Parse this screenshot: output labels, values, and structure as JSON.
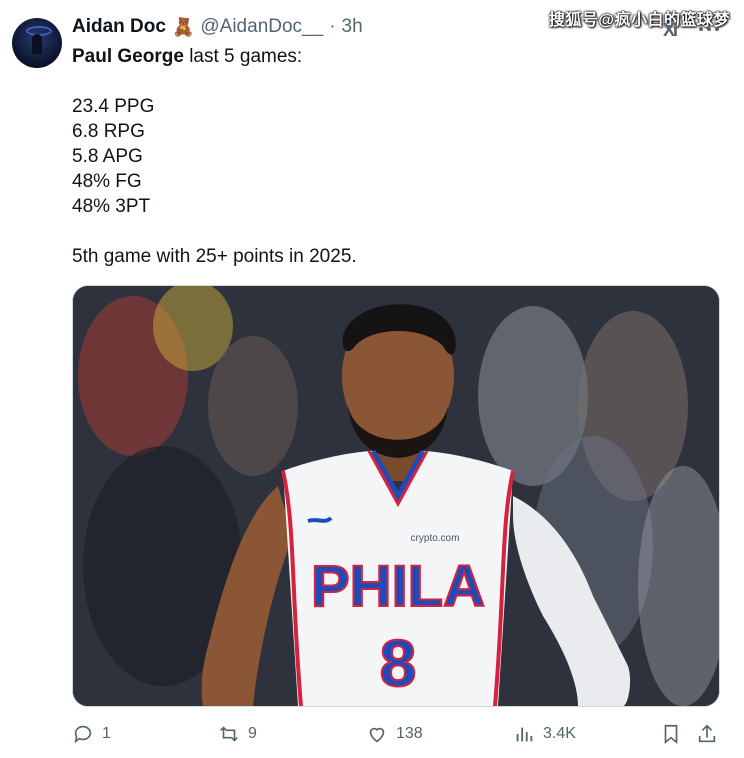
{
  "watermark": "搜狐号@疯小白的篮球梦",
  "author": {
    "name": "Aidan Doc",
    "emoji": "🧸",
    "handle": "@AidanDoc__",
    "separator": "·",
    "time": "3h"
  },
  "header_icons": {
    "logo": "XI",
    "more": "more-icon"
  },
  "tweet": {
    "player": "Paul George",
    "intro_rest": " last 5 games:",
    "stats": [
      "23.4 PPG",
      "6.8 RPG",
      "5.8 APG",
      "48% FG",
      "48% 3PT"
    ],
    "closing": "5th game with 25+ points in 2025."
  },
  "media": {
    "jersey_text": "PHILA",
    "jersey_number": "8",
    "sponsor": "crypto.com"
  },
  "actions": {
    "replies": "1",
    "reposts": "9",
    "likes": "138",
    "views": "3.4K"
  },
  "colors": {
    "text": "#0f1419",
    "secondary": "#536471",
    "jersey_blue": "#1d4bb8",
    "jersey_red": "#d6213f"
  }
}
